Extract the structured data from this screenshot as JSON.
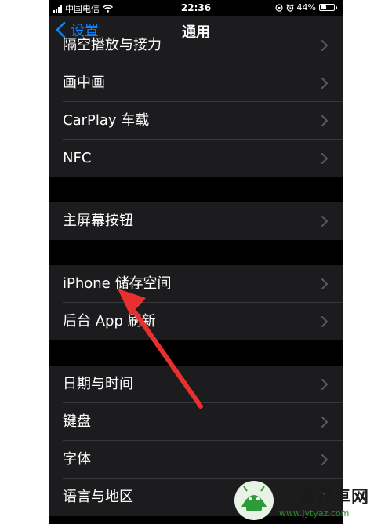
{
  "status_bar": {
    "carrier": "中国电信",
    "time": "22:36",
    "battery_percent": "44%",
    "battery_level": 0.44,
    "signal_icon": "signal-bars-icon",
    "wifi_icon": "wifi-icon",
    "orientation_lock_icon": "orientation-lock-icon",
    "alarm_icon": "alarm-icon"
  },
  "nav": {
    "back_label": "设置",
    "title": "通用"
  },
  "list": {
    "partial_item": "隔空播放与接力",
    "group1": [
      "画中画",
      "CarPlay 车载",
      "NFC"
    ],
    "group2": [
      "主屏幕按钮"
    ],
    "group3": [
      "iPhone 储存空间",
      "后台 App 刷新"
    ],
    "group4": [
      "日期与时间",
      "键盘",
      "字体",
      "语言与地区"
    ]
  },
  "annotation": {
    "arrow_color": "#e8312f"
  },
  "watermark": {
    "title": "天源安卓网",
    "url": "www.jytyaz.com"
  },
  "colors": {
    "accent": "#0a84ff",
    "row_bg": "#1c1c1e",
    "separator": "#38383a",
    "chevron": "#5a5a5e"
  }
}
